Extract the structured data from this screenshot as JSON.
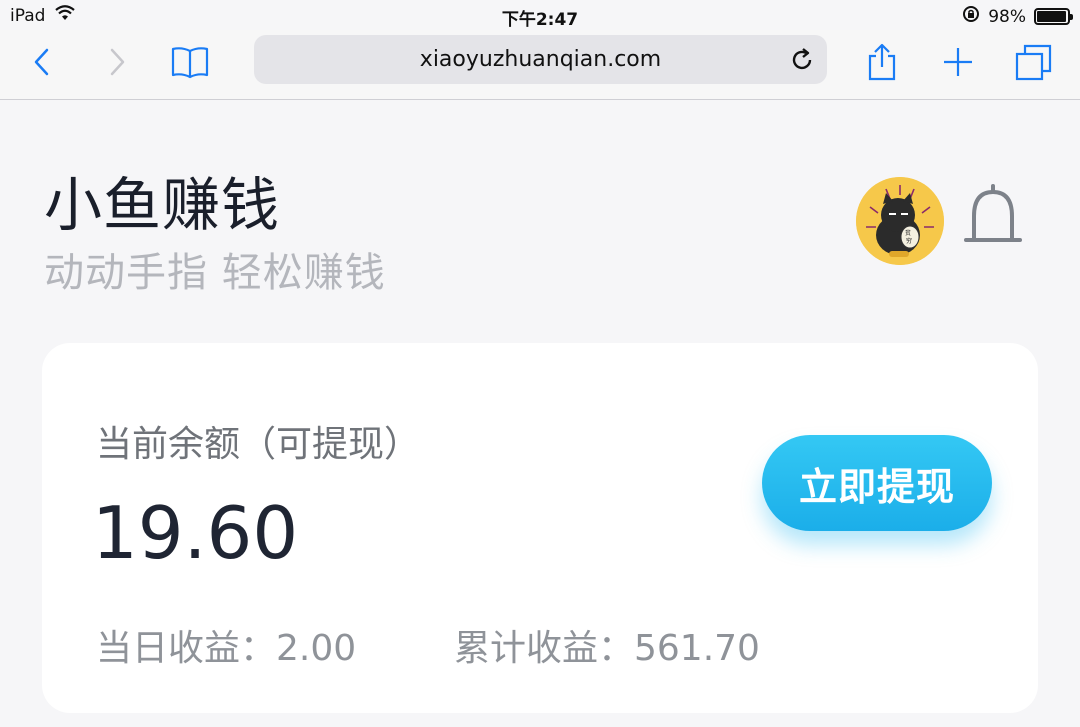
{
  "status_bar": {
    "device": "iPad",
    "time": "下午2:47",
    "battery": "98%",
    "battery_level": 0.98
  },
  "browser": {
    "url": "xiaoyuzhuanqian.com",
    "icons": [
      "back-icon",
      "forward-icon",
      "bookmarks-icon",
      "reload-icon",
      "share-icon",
      "new-tab-icon",
      "tabs-icon"
    ]
  },
  "header": {
    "title": "小鱼赚钱",
    "subtitle": "动动手指 轻松赚钱"
  },
  "balance": {
    "label": "当前余额（可提现）",
    "amount": "19.60",
    "withdraw_label": "立即提现",
    "today_earnings": "当日收益：2.00",
    "total_earnings": "累计收益：561.70"
  },
  "colors": {
    "accent": "#1baee9",
    "ios_blue": "#1a7cf5"
  }
}
